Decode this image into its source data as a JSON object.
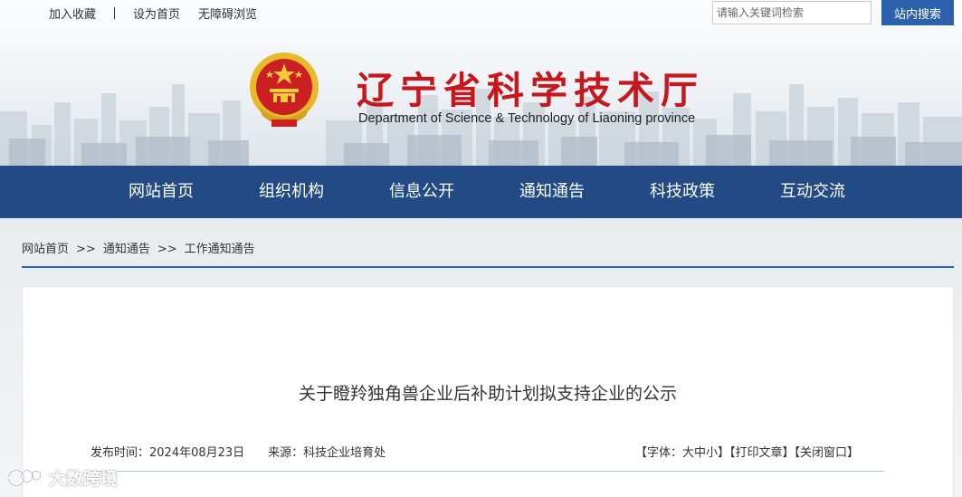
{
  "top_links": [
    "加入收藏",
    "设为首页",
    "无障碍浏览"
  ],
  "search": {
    "placeholder": "请输入关键词检索",
    "button": "站内搜索"
  },
  "site": {
    "title_cn": "辽宁省科学技术厅",
    "title_en": "Department of Science & Technology of Liaoning province"
  },
  "nav": [
    "网站首页",
    "组织机构",
    "信息公开",
    "通知通告",
    "科技政策",
    "互动交流"
  ],
  "breadcrumb": [
    "网站首页",
    "通知通告",
    "工作通知通告"
  ],
  "breadcrumb_sep": ">>",
  "article": {
    "title": "关于瞪羚独角兽企业后补助计划拟支持企业的公示",
    "publish_time": "发布时间：2024年08月23日",
    "source": "来源：科技企业培育处",
    "font_size_link": "【字体：大中小】",
    "print_link": "【打印文章】",
    "close_link": "【关闭窗口】"
  },
  "watermark": "大数跨境",
  "colors": {
    "brand_red": "#c8161d",
    "nav_blue": "#224a84",
    "accent_blue": "#2c61ad"
  }
}
